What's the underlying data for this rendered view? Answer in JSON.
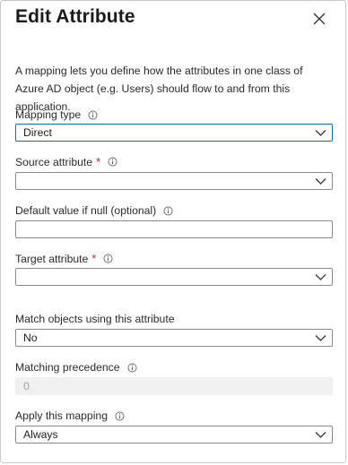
{
  "panel": {
    "title": "Edit Attribute",
    "description": "A mapping lets you define how the attributes in one class of Azure AD object (e.g. Users) should flow to and from this application."
  },
  "fields": {
    "mapping_type": {
      "label": "Mapping type",
      "value": "Direct"
    },
    "source_attribute": {
      "label": "Source attribute",
      "required_mark": "*",
      "value": ""
    },
    "default_value": {
      "label": "Default value if null (optional)",
      "value": ""
    },
    "target_attribute": {
      "label": "Target attribute",
      "required_mark": "*",
      "value": ""
    },
    "match_objects": {
      "label": "Match objects using this attribute",
      "value": "No"
    },
    "matching_precedence": {
      "label": "Matching precedence",
      "value": "0"
    },
    "apply_mapping": {
      "label": "Apply this mapping",
      "value": "Always"
    }
  },
  "icons": {
    "close": "close-icon",
    "info": "info-icon",
    "dropdown": "chevron-down-icon"
  },
  "colors": {
    "focus_border": "#0f6cbd",
    "required": "#c4262e",
    "disabled_bg": "#f0f0f0"
  }
}
